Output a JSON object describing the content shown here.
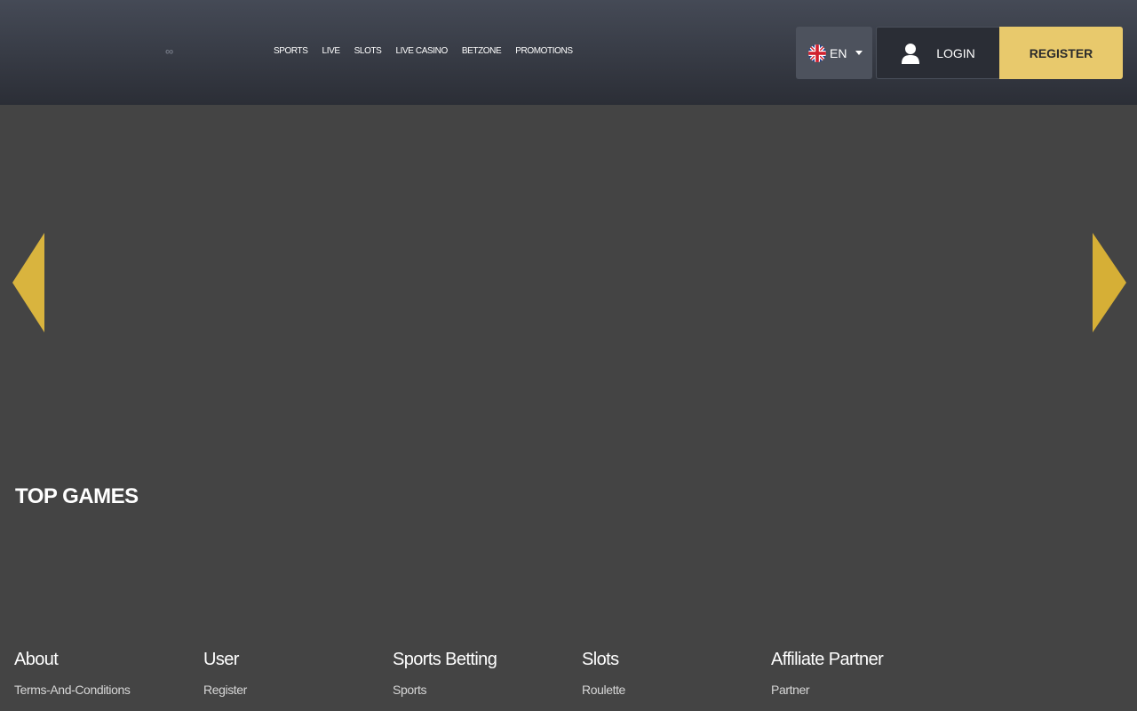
{
  "header": {
    "logo_glyph": "∞",
    "nav": [
      "SPORTS",
      "LIVE",
      "SLOTS",
      "LIVE CASINO",
      "BETZONE",
      "PROMOTIONS"
    ],
    "language": {
      "code": "EN",
      "flag_icon": "uk-flag-icon"
    },
    "login_label": "LOGIN",
    "register_label": "REGISTER"
  },
  "carousel": {
    "prev_icon": "triangle-left-icon",
    "next_icon": "triangle-right-icon"
  },
  "top_games": {
    "title": "TOP GAMES"
  },
  "footer": {
    "columns": [
      {
        "title": "About",
        "links": [
          "Terms-And-Conditions"
        ]
      },
      {
        "title": "User",
        "links": [
          "Register"
        ]
      },
      {
        "title": "Sports Betting",
        "links": [
          "Sports"
        ]
      },
      {
        "title": "Slots",
        "links": [
          "Roulette"
        ]
      },
      {
        "title": "Affiliate Partner",
        "links": [
          "Partner"
        ]
      }
    ]
  },
  "colors": {
    "page_bg": "#444444",
    "header_top": "#454a56",
    "header_bottom": "#2b2e36",
    "accent_gold": "#e8c96c",
    "arrow_gold": "#d9b43e"
  }
}
